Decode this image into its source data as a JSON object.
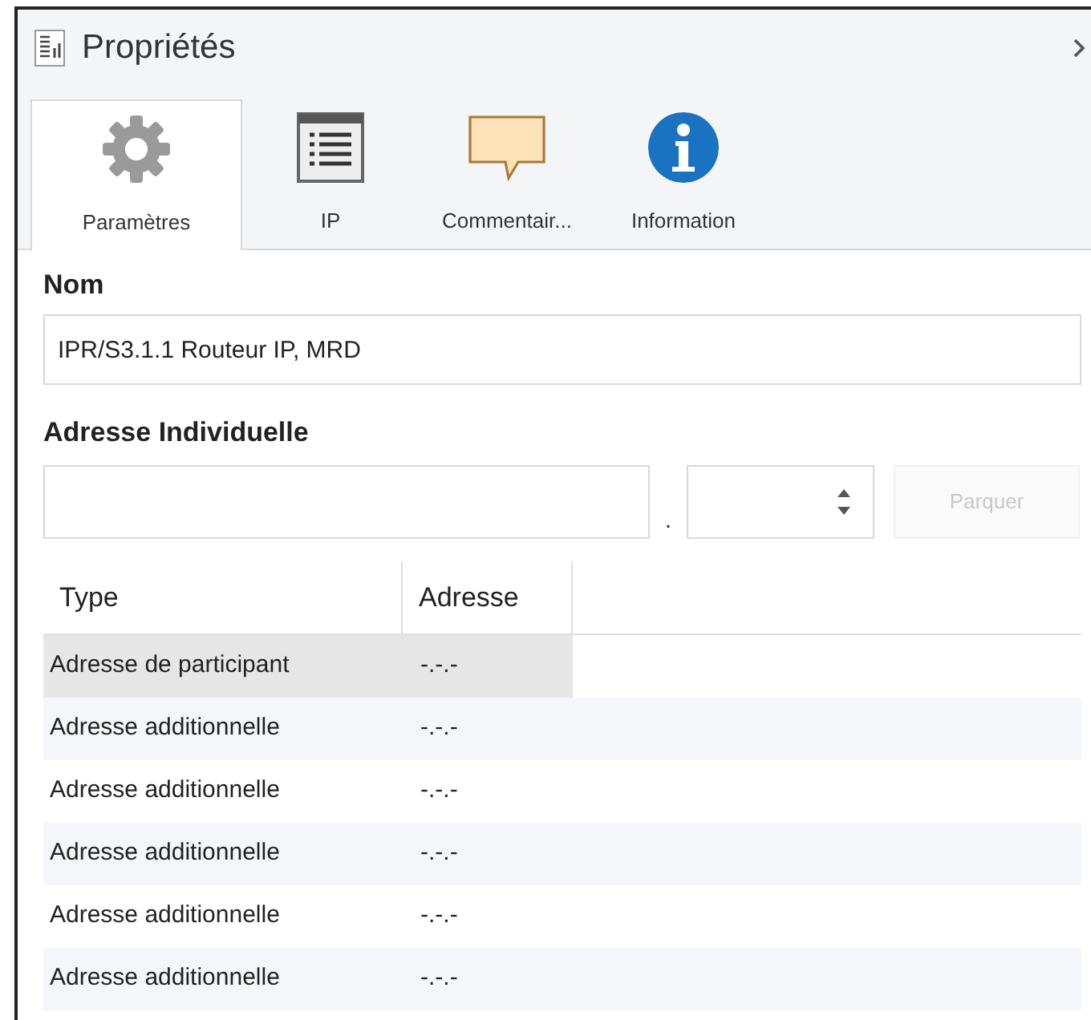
{
  "panel": {
    "title": "Propriétés"
  },
  "tabs": [
    {
      "label": "Paramètres",
      "kind": "gear",
      "selected": true
    },
    {
      "label": "IP",
      "kind": "list",
      "selected": false
    },
    {
      "label": "Commentair...",
      "kind": "comment",
      "selected": false
    },
    {
      "label": "Information",
      "kind": "info",
      "selected": false
    }
  ],
  "name_field": {
    "label": "Nom",
    "value": "IPR/S3.1.1 Routeur IP, MRD"
  },
  "address": {
    "label": "Adresse Individuelle",
    "separator": ".",
    "park_button": {
      "label": "Parquer",
      "disabled": true
    }
  },
  "table": {
    "columns": [
      "Type",
      "Adresse"
    ],
    "rows": [
      {
        "type": "Adresse de participant",
        "address": "-.-.-",
        "selected": true
      },
      {
        "type": "Adresse additionnelle",
        "address": "-.-.-",
        "selected": false
      },
      {
        "type": "Adresse additionnelle",
        "address": "-.-.-",
        "selected": false
      },
      {
        "type": "Adresse additionnelle",
        "address": "-.-.-",
        "selected": false
      },
      {
        "type": "Adresse additionnelle",
        "address": "-.-.-",
        "selected": false
      },
      {
        "type": "Adresse additionnelle",
        "address": "-.-.-",
        "selected": false
      }
    ]
  }
}
